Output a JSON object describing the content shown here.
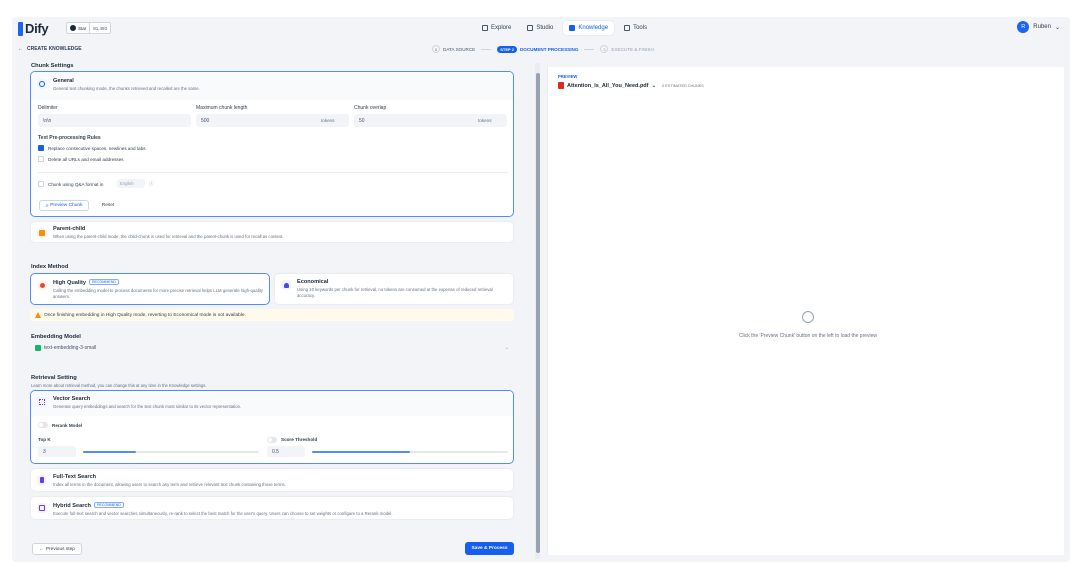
{
  "app": {
    "name": "Dify",
    "star_label": "Star",
    "star_count": "81,493"
  },
  "nav": {
    "links": [
      {
        "label": "Explore"
      },
      {
        "label": "Studio"
      },
      {
        "label": "Knowledge"
      },
      {
        "label": "Tools"
      }
    ],
    "active_index": 2
  },
  "user": {
    "initial": "R",
    "name": "Ruben"
  },
  "header": {
    "back_label": "CREATE KNOWLEDGE"
  },
  "steps": [
    {
      "num": "1",
      "label": "DATA SOURCE",
      "state": "done"
    },
    {
      "pill": "STEP 2",
      "label": "DOCUMENT PROCESSING",
      "state": "active"
    },
    {
      "num": "3",
      "label": "EXECUTE & FINISH",
      "state": "disabled"
    }
  ],
  "chunk_settings": {
    "title": "Chunk Settings",
    "general": {
      "title": "General",
      "desc": "General text chunking mode, the chunks retrieved and recalled are the same.",
      "delimiter_label": "Delimiter",
      "delimiter_value": "\\n\\n",
      "max_len_label": "Maximum chunk length",
      "max_len_value": "500",
      "overlap_label": "Chunk overlap",
      "overlap_value": "50",
      "unit": "tokens",
      "preproc_title": "Text Pre-processing Rules",
      "rule1": "Replace consecutive spaces, newlines and tabs",
      "rule2": "Delete all URLs and email addresses",
      "qa_label": "Chunk using Q&A format in",
      "qa_lang": "English",
      "preview_btn": "Preview Chunk",
      "reset_btn": "Reset"
    },
    "parent_child": {
      "title": "Parent-child",
      "desc": "When using the parent-child mode, the child-chunk is used for retrieval and the parent-chunk is used for recall as context."
    }
  },
  "index_method": {
    "title": "Index Method",
    "high_quality": {
      "title": "High Quality",
      "badge": "RECOMMEND",
      "desc": "Calling the embedding model to process documents for more precise retrieval helps LLM generate high-quality answers."
    },
    "economical": {
      "title": "Economical",
      "desc": "Using 10 keywords per chunk for retrieval, no tokens are consumed at the expense of reduced retrieval accuracy."
    },
    "warning": "Once finishing embedding in High Quality mode, reverting to Economical mode is not available."
  },
  "embedding": {
    "title": "Embedding Model",
    "value": "text-embedding-3-small"
  },
  "retrieval": {
    "title": "Retrieval Setting",
    "subtitle": "Learn more about retrieval method, you can change this at any time in the Knowledge settings.",
    "vector": {
      "title": "Vector Search",
      "desc": "Generate query embeddings and search for the text chunk most similar to its vector representation.",
      "rerank_label": "Rerank Model",
      "topk_label": "Top K",
      "topk_value": "3",
      "topk_fraction": 0.3,
      "score_label": "Score Threshold",
      "score_value": "0.5",
      "score_fraction": 0.5
    },
    "fulltext": {
      "title": "Full-Text Search",
      "desc": "Index all terms in the document, allowing users to search any term and retrieve relevant text chunk containing those terms."
    },
    "hybrid": {
      "title": "Hybrid Search",
      "badge": "RECOMMEND",
      "desc": "Execute full-text search and vector searches simultaneously, re-rank to select the best match for the user's query. Users can choose to set weights or configure to a Rerank model."
    }
  },
  "footer": {
    "prev_label": "Previous step",
    "save_label": "Save & Process"
  },
  "preview": {
    "label": "PREVIEW",
    "file": "Attention_is_All_You_Need.pdf",
    "chunks": "0 ESTIMATED CHUNKS",
    "empty": "Click the 'Preview Chunk' button on the left to load the preview"
  },
  "colors": {
    "primary": "#155eef",
    "selected_border": "#528bff",
    "warning_bg": "#fffaeb"
  }
}
